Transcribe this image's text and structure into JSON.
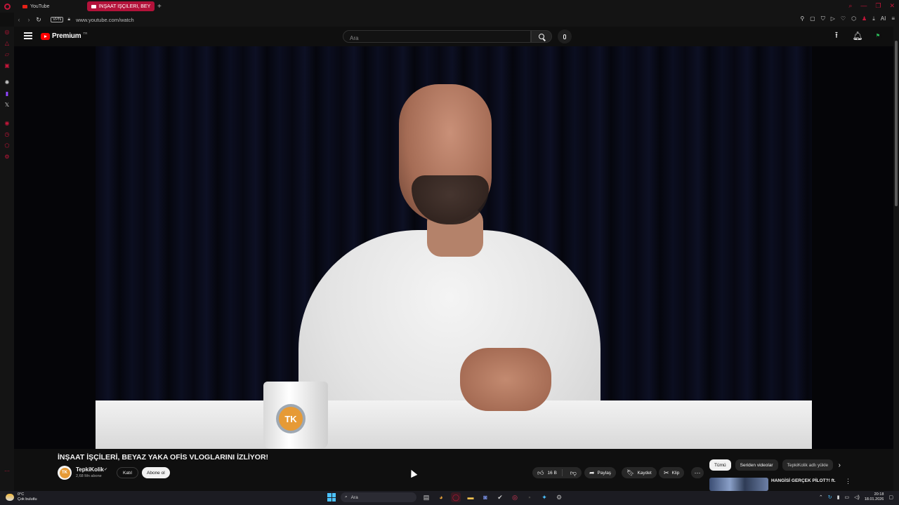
{
  "browser": {
    "tabs": [
      {
        "label": "YouTube"
      },
      {
        "label": "İNŞAAT İŞÇİLERİ, BEYA"
      }
    ],
    "url": "www.youtube.com/watch",
    "vpn_label": "VPN",
    "ai_label": "AI"
  },
  "youtube": {
    "logo_text": "Premium",
    "country_code": "TR",
    "search_placeholder": "Ara"
  },
  "video": {
    "mug_logo": "TK",
    "title": "İNŞAAT İŞÇİLERİ, BEYAZ YAKA OFİS VLOGLARINI İZLİYOR!",
    "channel": {
      "avatar_text": "TK",
      "name": "TepkiKolik",
      "subscribers": "2,68 Mn abone",
      "join_label": "Katıl",
      "subscribe_label": "Abone ol"
    },
    "actions": {
      "like_count": "16 B",
      "share_label": "Paylaş",
      "save_label": "Kaydet",
      "clip_label": "Klip"
    }
  },
  "chips": [
    {
      "label": "Tümü",
      "selected": true
    },
    {
      "label": "Seriden videolar",
      "selected": false
    },
    {
      "label": "TepkiKolik adlı yükle",
      "selected": false
    }
  ],
  "recommendation": {
    "title": "HANGİSİ GERÇEK PİLOT?! ft."
  },
  "taskbar": {
    "weather_temp": "0°C",
    "weather_desc": "Çok bulutlu",
    "search_label": "Ara",
    "time": "20:18",
    "date": "18.01.2026"
  },
  "colors": {
    "youtube_red": "#ff0000",
    "opera_red": "#c4163a",
    "background": "#0f0f0f"
  }
}
